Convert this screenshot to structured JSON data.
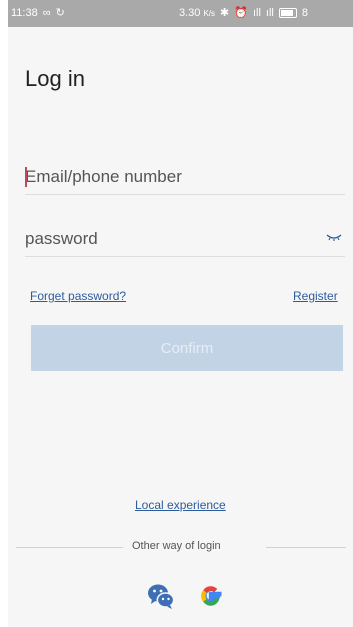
{
  "status_bar": {
    "time": "11:38",
    "link_glyph": "∞",
    "sync_glyph": "↻",
    "speed": "3.30",
    "speed_unit": "K/s",
    "bluetooth_glyph": "✱",
    "alarm_glyph": "⏰",
    "signal_glyph": "ıll",
    "battery_text": "8"
  },
  "login": {
    "title": "Log in",
    "email_placeholder": "Email/phone number",
    "password_placeholder": "password",
    "forget_label": "Forget password?",
    "register_label": "Register",
    "confirm_label": "Confirm",
    "local_label": "Local experience",
    "other_login_label": "Other way of login"
  },
  "colors": {
    "link": "#2d5c9c",
    "confirm_bg": "#c3d3e6",
    "status_bar": "#a9a9a9",
    "wechat": "#3e6fb4"
  },
  "icons": [
    "eye-closed-icon",
    "wechat-icon",
    "google-icon",
    "bluetooth-icon",
    "alarm-icon",
    "signal-icon",
    "battery-icon"
  ]
}
